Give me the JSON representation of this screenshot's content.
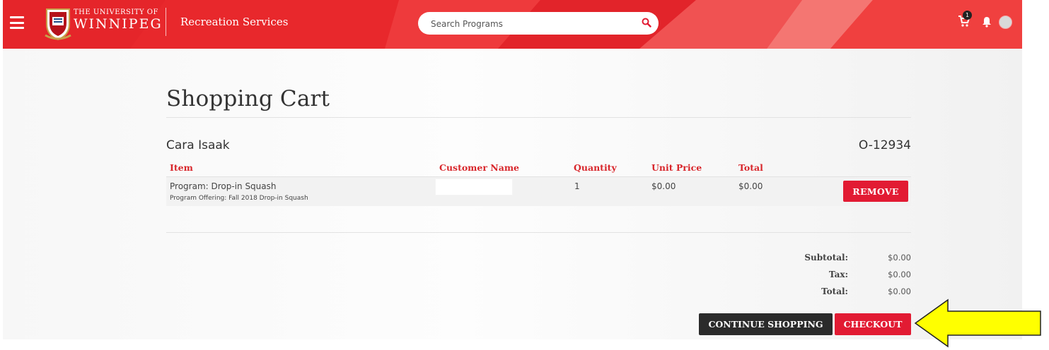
{
  "header": {
    "university_line1": "THE UNIVERSITY OF",
    "university_line2": "WINNIPEG",
    "service_name": "Recreation Services",
    "search_placeholder": "Search Programs",
    "cart_count": "1",
    "brand_color": "#e8282c"
  },
  "page": {
    "title": "Shopping Cart",
    "customer_name": "Cara Isaak",
    "order_number": "O-12934"
  },
  "table": {
    "headers": [
      "Item",
      "Customer Name",
      "Quantity",
      "Unit Price",
      "Total"
    ],
    "rows": [
      {
        "item": "Program: Drop-in Squash",
        "offering": "Program Offering: Fall 2018 Drop-in Squash",
        "customer_name": "",
        "quantity": "1",
        "unit_price": "$0.00",
        "total": "$0.00",
        "remove_label": "REMOVE"
      }
    ]
  },
  "summary": {
    "subtotal_label": "Subtotal:",
    "subtotal_value": "$0.00",
    "tax_label": "Tax:",
    "tax_value": "$0.00",
    "total_label": "Total:",
    "total_value": "$0.00"
  },
  "actions": {
    "continue_label": "CONTINUE SHOPPING",
    "checkout_label": "CHECKOUT"
  },
  "icons": {
    "menu": "hamburger-menu-icon",
    "search": "search-icon",
    "cart": "cart-icon",
    "bell": "bell-icon",
    "arrow": "pointer-arrow-icon"
  }
}
